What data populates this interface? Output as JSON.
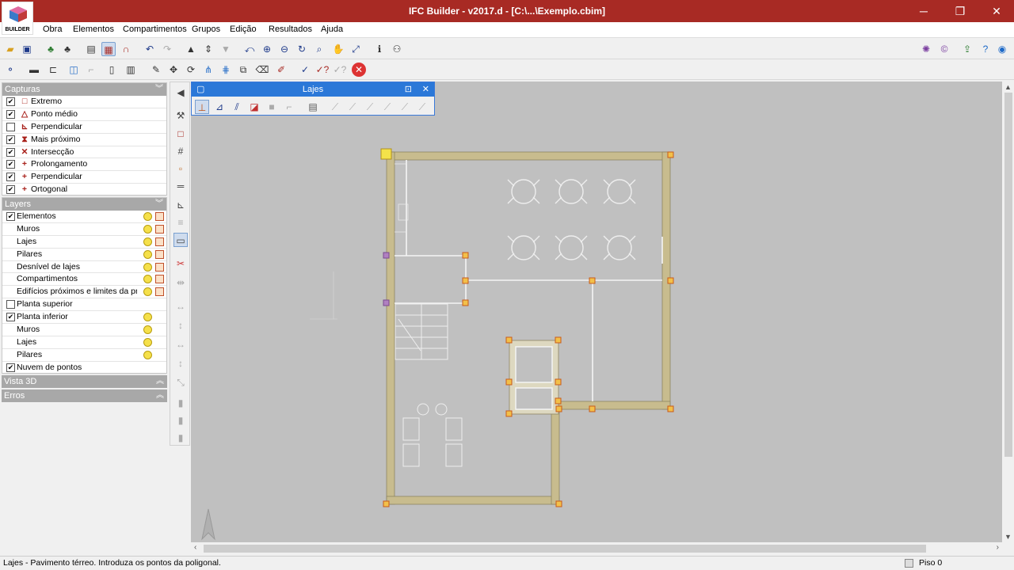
{
  "window": {
    "title": "IFC Builder - v2017.d - [C:\\...\\Exemplo.cbim]",
    "minimize": "─",
    "restore": "❐",
    "close": "✕"
  },
  "logo": {
    "label": "BUILDER"
  },
  "menu": [
    "Obra",
    "Elementos",
    "Compartimentos",
    "Grupos",
    "Edição",
    "Resultados",
    "Ajuda"
  ],
  "capturas": {
    "title": "Capturas",
    "items": [
      {
        "label": "Extremo",
        "checked": true,
        "symbol": "□"
      },
      {
        "label": "Ponto médio",
        "checked": true,
        "symbol": "△"
      },
      {
        "label": "Perpendicular",
        "checked": false,
        "symbol": "⊾"
      },
      {
        "label": "Mais próximo",
        "checked": true,
        "symbol": "⧗"
      },
      {
        "label": "Intersecção",
        "checked": true,
        "symbol": "✕"
      },
      {
        "label": "Prolongamento",
        "checked": true,
        "symbol": "+"
      },
      {
        "label": "Perpendicular",
        "checked": true,
        "symbol": "+"
      },
      {
        "label": "Ortogonal",
        "checked": true,
        "symbol": "+"
      }
    ]
  },
  "layers": {
    "title": "Layers",
    "items": [
      {
        "label": "Elementos",
        "checked": true,
        "indent": false,
        "lock": true
      },
      {
        "label": "Muros",
        "indent": true,
        "lock": true
      },
      {
        "label": "Lajes",
        "indent": true,
        "lock": true
      },
      {
        "label": "Pilares",
        "indent": true,
        "lock": true
      },
      {
        "label": "Desnível de lajes",
        "indent": true,
        "lock": true
      },
      {
        "label": "Compartimentos",
        "indent": true,
        "lock": true
      },
      {
        "label": "Edifícios próximos e limites da pr...",
        "indent": true,
        "lock": true
      },
      {
        "label": "Planta superior",
        "checked": false,
        "indent": false,
        "nobulb": true
      },
      {
        "label": "Planta inferior",
        "checked": true,
        "indent": false
      },
      {
        "label": "Muros",
        "indent": true
      },
      {
        "label": "Lajes",
        "indent": true
      },
      {
        "label": "Pilares",
        "indent": true
      },
      {
        "label": "Nuvem de pontos",
        "checked": true,
        "indent": false,
        "nobulb": true
      }
    ]
  },
  "vista3d": {
    "title": "Vista 3D"
  },
  "erros": {
    "title": "Erros"
  },
  "floating": {
    "title": "Lajes",
    "pin": "⊡",
    "close": "✕"
  },
  "status": {
    "message": "Lajes - Pavimento térreo.  Introduza os pontos da poligonal.",
    "floor": "Piso 0"
  },
  "colors": {
    "titlebar": "#a82a24",
    "float_header": "#2b78d8",
    "panel_header": "#a8a8a8",
    "canvas": "#c0c0c0",
    "wall": "#c8bc8e"
  }
}
